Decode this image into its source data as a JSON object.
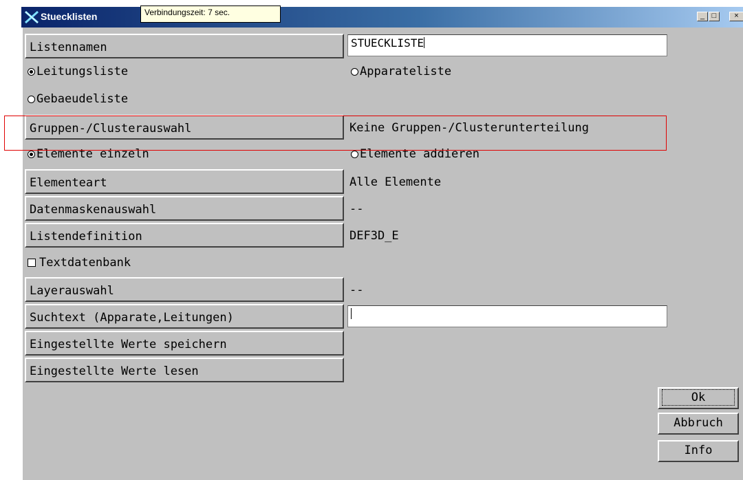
{
  "window": {
    "title": "Stuecklisten",
    "tooltip": "Verbindungszeit: 7 sec.",
    "controls": {
      "minimize": "_",
      "maximize": "□",
      "close": "×"
    }
  },
  "form": {
    "listennamen": {
      "button": "Listennamen",
      "value": "STUECKLISTE"
    },
    "list_type": {
      "leitungsliste": {
        "label": "Leitungsliste",
        "selected": true
      },
      "apparateliste": {
        "label": "Apparateliste",
        "selected": false
      },
      "gebaeudeliste": {
        "label": "Gebaeudeliste",
        "selected": false
      }
    },
    "gruppen": {
      "button": "Gruppen-/Clusterauswahl",
      "value": "Keine Gruppen-/Clusterunterteilung"
    },
    "element_mode": {
      "einzeln": {
        "label": "Elemente einzeln",
        "selected": true
      },
      "addieren": {
        "label": "Elemente addieren",
        "selected": false
      }
    },
    "elementeart": {
      "button": "Elementeart",
      "value": "Alle Elemente"
    },
    "datenmaske": {
      "button": "Datenmaskenauswahl",
      "value": "--"
    },
    "listendefinition": {
      "button": "Listendefinition",
      "value": "DEF3D_E"
    },
    "textdatenbank": {
      "label": "Textdatenbank",
      "checked": false
    },
    "layerauswahl": {
      "button": "Layerauswahl",
      "value": "--"
    },
    "suchtext": {
      "button": "Suchtext (Apparate,Leitungen)",
      "value": ""
    },
    "speichern": {
      "button": "Eingestellte Werte speichern"
    },
    "lesen": {
      "button": "Eingestellte Werte lesen"
    }
  },
  "actions": {
    "ok": "Ok",
    "abbruch": "Abbruch",
    "info": "Info"
  },
  "colors": {
    "titlebar": "#0a246a",
    "highlight": "#e00000",
    "window_bg": "#c0c0c0"
  }
}
